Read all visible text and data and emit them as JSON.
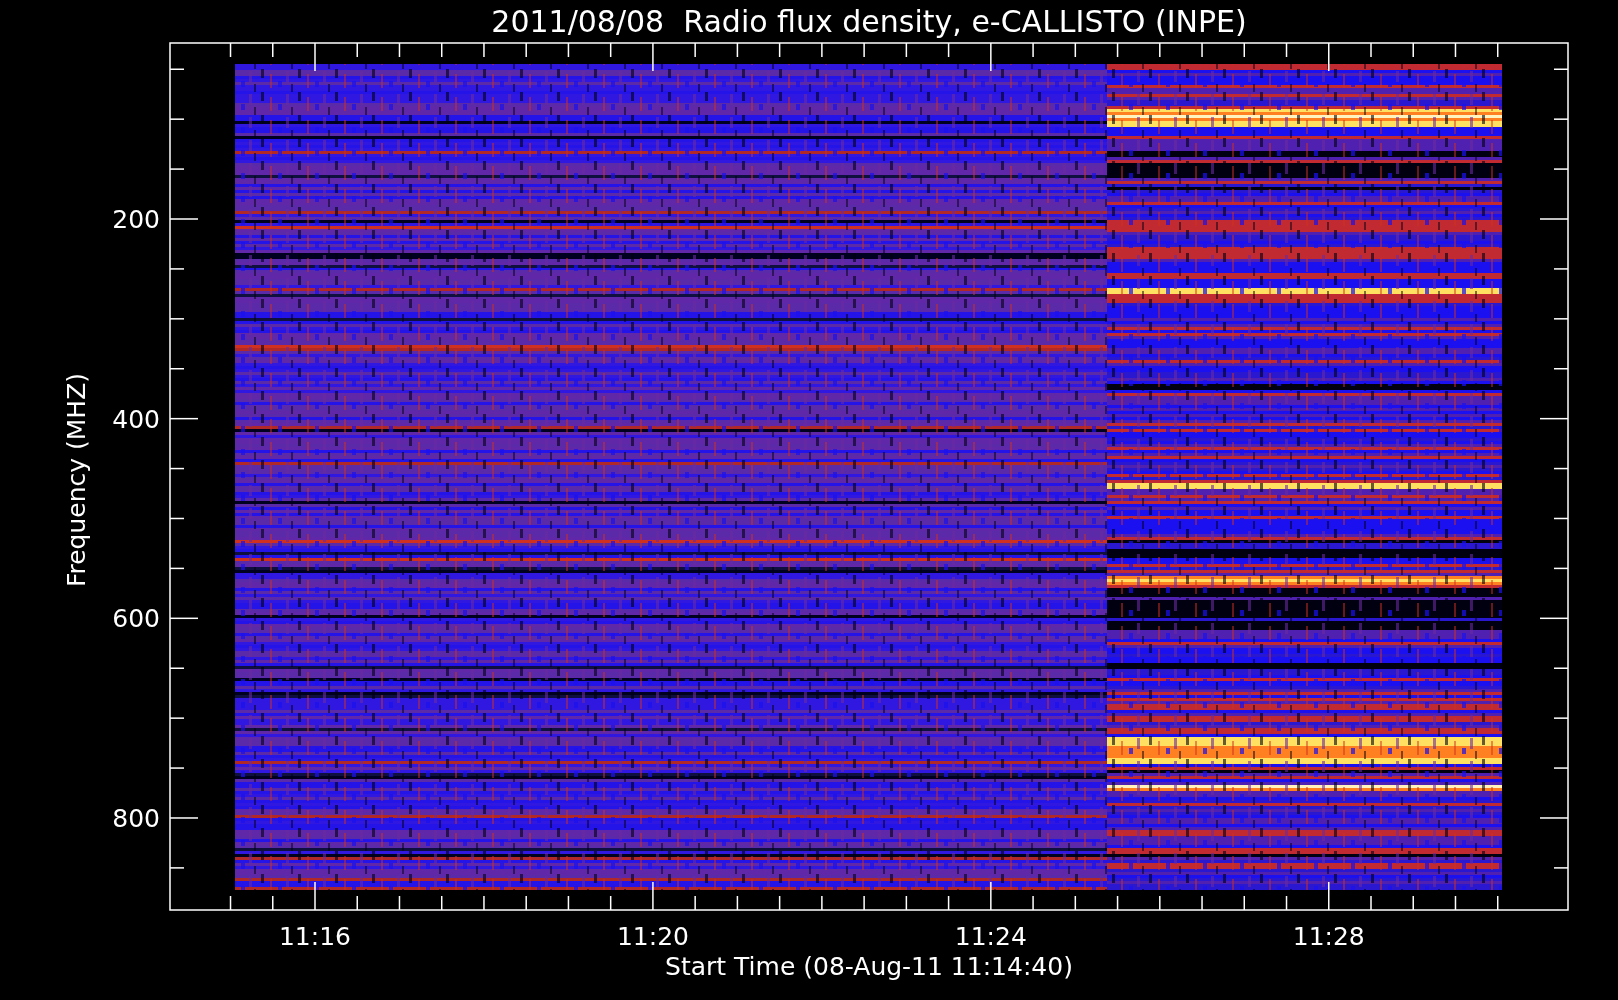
{
  "title": "2011/08/08  Radio flux density, e-CALLISTO (INPE)",
  "y_axis": {
    "label": "Frequency (MHZ)",
    "tick_labels": [
      "200",
      "400",
      "600",
      "800"
    ]
  },
  "x_axis": {
    "label": "Start Time (08-Aug-11 11:14:40)",
    "tick_labels": [
      "11:16",
      "11:20",
      "11:24",
      "11:28"
    ]
  }
}
